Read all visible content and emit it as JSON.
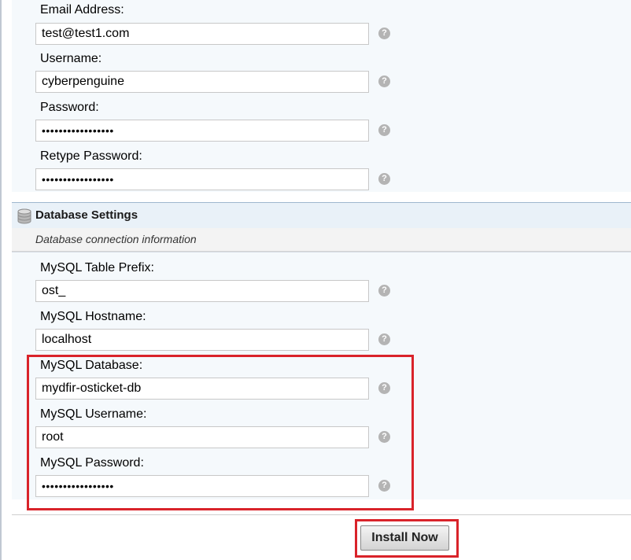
{
  "admin": {
    "email": {
      "label": "Email Address:",
      "value": "test@test1.com"
    },
    "username": {
      "label": "Username:",
      "value": "cyberpenguine"
    },
    "password": {
      "label": "Password:",
      "value": "•••••••••••••••••"
    },
    "retype_password": {
      "label": "Retype Password:",
      "value": "•••••••••••••••••"
    }
  },
  "database": {
    "title": "Database Settings",
    "subtitle": "Database connection information",
    "icon": "database-icon",
    "table_prefix": {
      "label": "MySQL Table Prefix:",
      "value": "ost_"
    },
    "hostname": {
      "label": "MySQL Hostname:",
      "value": "localhost"
    },
    "db_name": {
      "label": "MySQL Database:",
      "value": "mydfir-osticket-db"
    },
    "db_username": {
      "label": "MySQL Username:",
      "value": "root"
    },
    "db_password": {
      "label": "MySQL Password:",
      "value": "•••••••••••••••••"
    }
  },
  "help_icon": "?",
  "install_button": "Install Now",
  "colors": {
    "highlight": "#d9232a",
    "panel_bg": "#f5f9fc",
    "section_header_bg": "#e9f1f8"
  }
}
